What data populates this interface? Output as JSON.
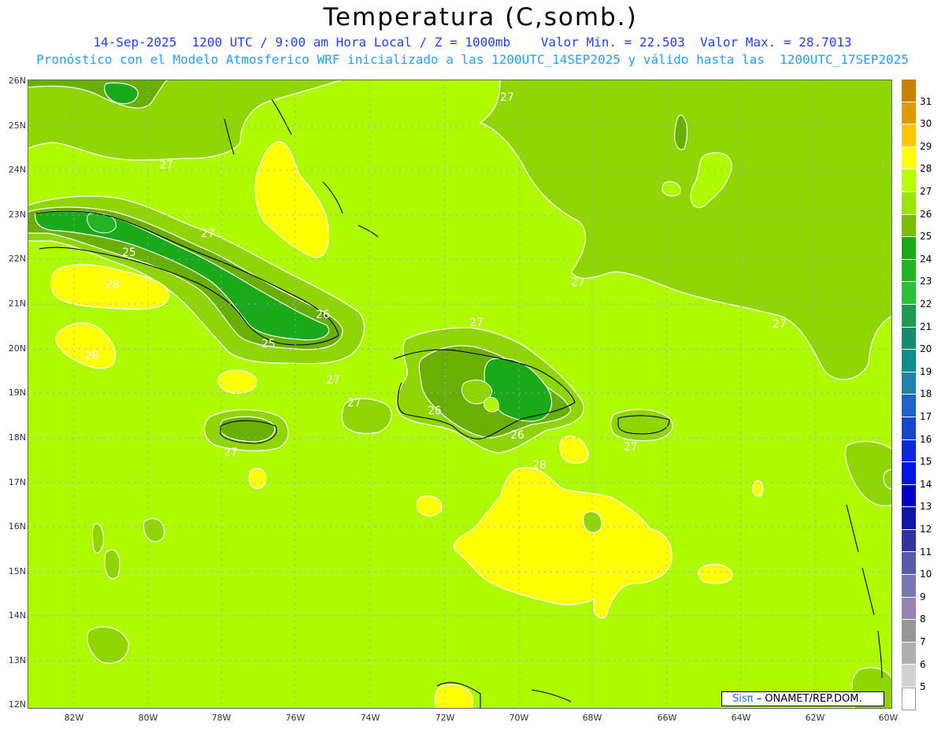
{
  "title": "Temperatura (C,somb.)",
  "subtitle_line1": "14-Sep-2025  1200 UTC / 9:00 am Hora Local / Z = 1000mb    Valor Min. = 22.503  Valor Max. = 28.7013",
  "subtitle_line2": "Pronóstico con el Modelo Atmosferico WRF inicializado a las 1200UTC_14SEP2025 y válido hasta las  1200UTC_17SEP2025",
  "map": {
    "lat_labels": [
      "26N",
      "25N",
      "24N",
      "23N",
      "22N",
      "21N",
      "20N",
      "19N",
      "18N",
      "17N",
      "16N",
      "15N",
      "14N",
      "13N",
      "12N"
    ],
    "lon_labels": [
      "82W",
      "80W",
      "78W",
      "76W",
      "74W",
      "72W",
      "70W",
      "68W",
      "66W",
      "64W",
      "62W",
      "60W"
    ],
    "contour_labels": [
      {
        "text": "27",
        "id": "c1"
      },
      {
        "text": "27",
        "id": "c2"
      },
      {
        "text": "27",
        "id": "c3"
      },
      {
        "text": "25",
        "id": "c4"
      },
      {
        "text": "28",
        "id": "c5"
      },
      {
        "text": "26",
        "id": "c6"
      },
      {
        "text": "25",
        "id": "c7"
      },
      {
        "text": "28",
        "id": "c8"
      },
      {
        "text": "27",
        "id": "c9"
      },
      {
        "text": "27",
        "id": "c10"
      },
      {
        "text": "27",
        "id": "c11"
      },
      {
        "text": "26",
        "id": "c12"
      },
      {
        "text": "26",
        "id": "c13"
      },
      {
        "text": "27",
        "id": "c14"
      },
      {
        "text": "27",
        "id": "c15"
      },
      {
        "text": "28",
        "id": "c16"
      },
      {
        "text": "27",
        "id": "c17"
      },
      {
        "text": "27",
        "id": "c18"
      }
    ],
    "colors": {
      "t25": "#19a919",
      "t26": "#69af00",
      "t27": "#8fd600",
      "t28": "#b0fa00",
      "t29": "#ffff00"
    }
  },
  "colorbar": {
    "levels": [
      {
        "label": "31",
        "color": "#c88200"
      },
      {
        "label": "30",
        "color": "#e19b00"
      },
      {
        "label": "29",
        "color": "#ffc800"
      },
      {
        "label": "28",
        "color": "#ffff00"
      },
      {
        "label": "27",
        "color": "#b9ff00"
      },
      {
        "label": "26",
        "color": "#9ae600"
      },
      {
        "label": "25",
        "color": "#78be00"
      },
      {
        "label": "24",
        "color": "#19aa19"
      },
      {
        "label": "23",
        "color": "#23b423"
      },
      {
        "label": "22",
        "color": "#2dbe3c"
      },
      {
        "label": "21",
        "color": "#1e9b50"
      },
      {
        "label": "20",
        "color": "#148c6e"
      },
      {
        "label": "19",
        "color": "#0f8c8c"
      },
      {
        "label": "18",
        "color": "#1e82aa"
      },
      {
        "label": "17",
        "color": "#1e64c8"
      },
      {
        "label": "16",
        "color": "#1446d2"
      },
      {
        "label": "15",
        "color": "#0a28dc"
      },
      {
        "label": "14",
        "color": "#0014e6"
      },
      {
        "label": "13",
        "color": "#0000c8"
      },
      {
        "label": "12",
        "color": "#1414aa"
      },
      {
        "label": "11",
        "color": "#3232a0"
      },
      {
        "label": "10",
        "color": "#5a5aaa"
      },
      {
        "label": "9",
        "color": "#7878b4"
      },
      {
        "label": "8",
        "color": "#9682b4"
      },
      {
        "label": "7",
        "color": "#969696"
      },
      {
        "label": "6",
        "color": "#afafaf"
      },
      {
        "label": "5",
        "color": "#d2d2d2"
      },
      {
        "label": "",
        "color": "#ffffff"
      }
    ]
  },
  "credit": {
    "brand": "Sisπ",
    "text": " – ONAMET/REP.DOM."
  }
}
